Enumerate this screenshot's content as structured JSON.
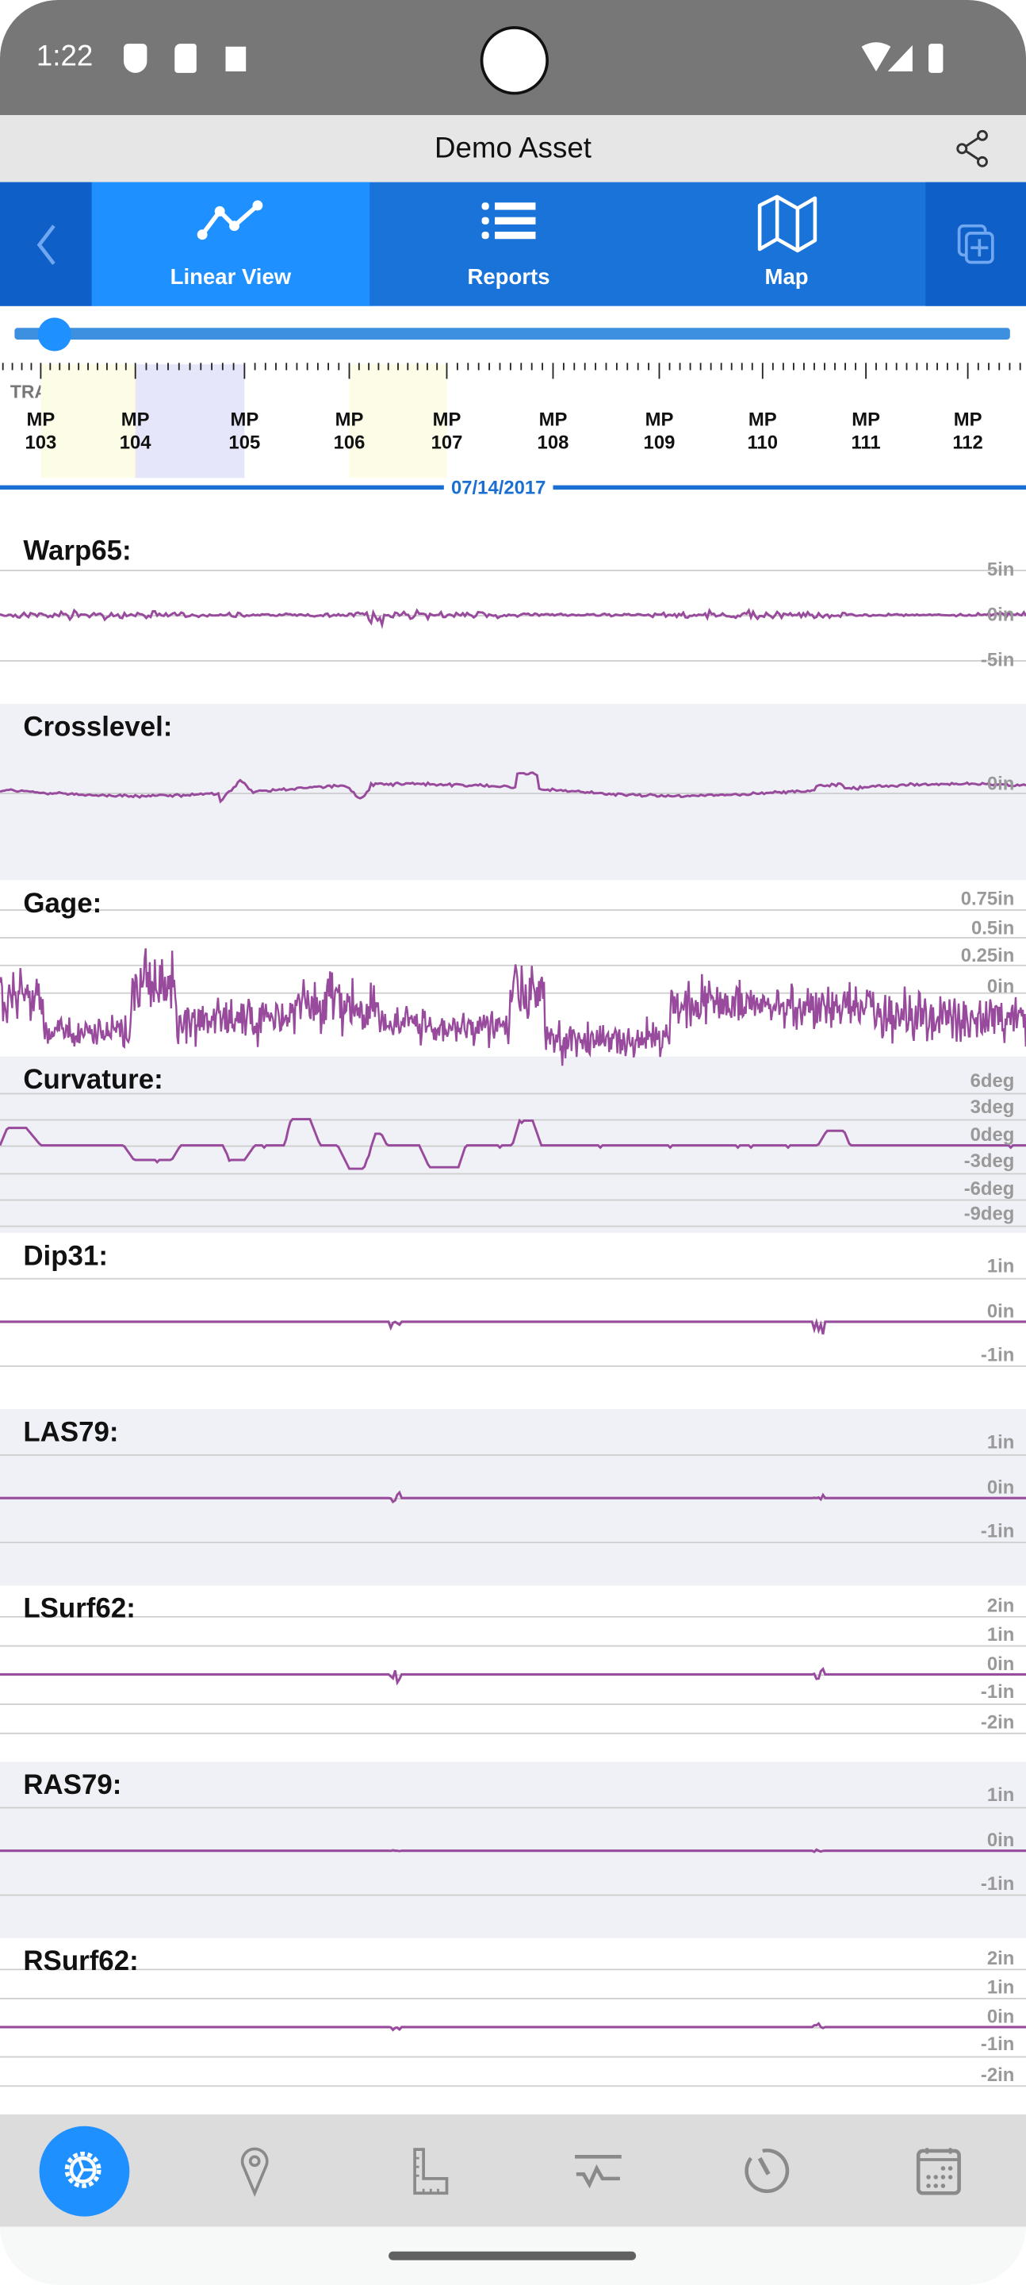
{
  "status_bar": {
    "time": "1:22",
    "icons": [
      "shield-icon",
      "sd-card-icon",
      "a-icon",
      "wifi-icon",
      "cell-signal-icon",
      "battery-icon"
    ]
  },
  "header": {
    "title": "Demo Asset",
    "share_icon": "share-icon"
  },
  "tabs": [
    {
      "label": "Linear View",
      "icon": "line-chart-icon",
      "active": true
    },
    {
      "label": "Reports",
      "icon": "list-icon",
      "active": false
    },
    {
      "label": "Map",
      "icon": "map-icon",
      "active": false
    }
  ],
  "slider": {
    "position_fraction": 0.04
  },
  "timeline": {
    "layer_label": "TRACK GEOMETRY",
    "mileposts": [
      {
        "top": "MP",
        "num": "103"
      },
      {
        "top": "MP",
        "num": "104"
      },
      {
        "top": "MP",
        "num": "105"
      },
      {
        "top": "MP",
        "num": "106"
      },
      {
        "top": "MP",
        "num": "107"
      },
      {
        "top": "MP",
        "num": "108"
      },
      {
        "top": "MP",
        "num": "109"
      },
      {
        "top": "MP",
        "num": "110"
      },
      {
        "top": "MP",
        "num": "111"
      },
      {
        "top": "MP",
        "num": "112"
      }
    ],
    "date": "07/14/2017"
  },
  "colors": {
    "accent": "#1e90ff",
    "tab_bar": "#1a73d9",
    "signal": "#984a9c",
    "highlight_yellow": "#fdfce6",
    "highlight_lavender": "#e6e6fa"
  },
  "charts": [
    {
      "title": "Warp65:",
      "labels": [
        "5in",
        "0in",
        "-5in"
      ]
    },
    {
      "title": "Crosslevel:",
      "labels": [
        "0in"
      ]
    },
    {
      "title": "Gage:",
      "labels": [
        "0.75in",
        "0.5in",
        "0.25in",
        "0in"
      ]
    },
    {
      "title": "Curvature:",
      "labels": [
        "6deg",
        "3deg",
        "0deg",
        "-3deg",
        "-6deg",
        "-9deg"
      ]
    },
    {
      "title": "Dip31:",
      "labels": [
        "1in",
        "0in",
        "-1in"
      ]
    },
    {
      "title": "LAS79:",
      "labels": [
        "1in",
        "0in",
        "-1in"
      ]
    },
    {
      "title": "LSurf62:",
      "labels": [
        "2in",
        "1in",
        "0in",
        "-1in",
        "-2in"
      ]
    },
    {
      "title": "RAS79:",
      "labels": [
        "1in",
        "0in",
        "-1in"
      ]
    },
    {
      "title": "RSurf62:",
      "labels": [
        "2in",
        "1in",
        "0in",
        "-1in",
        "-2in"
      ]
    }
  ],
  "bottom_nav": [
    "settings-icon",
    "location-pin-icon",
    "ruler-icon",
    "signal-wave-icon",
    "speedometer-icon",
    "calendar-icon"
  ]
}
